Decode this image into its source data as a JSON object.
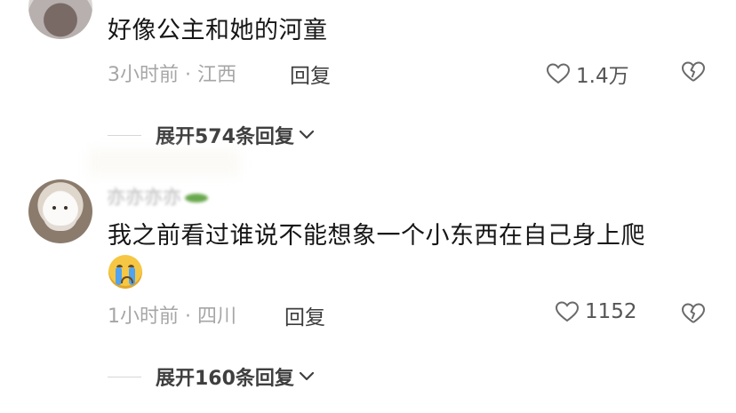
{
  "comments": [
    {
      "text": "好像公主和她的河童",
      "meta": "3小时前 · 江西",
      "reply_label": "回复",
      "likes": "1.4万",
      "expand_label": "展开574条回复"
    },
    {
      "username": "亦亦亦亦",
      "text": "我之前看过谁说不能想象一个小东西在自己身上爬",
      "emoji": "loudly-crying-face",
      "meta": "1小时前 · 四川",
      "reply_label": "回复",
      "likes": "1152",
      "expand_label": "展开160条回复"
    }
  ],
  "icons": {
    "like": "heart-outline-icon",
    "dislike": "broken-heart-icon",
    "expand": "chevron-down-icon"
  },
  "colors": {
    "text": "#161616",
    "meta": "#a6a6a6",
    "icon": "#555555"
  }
}
